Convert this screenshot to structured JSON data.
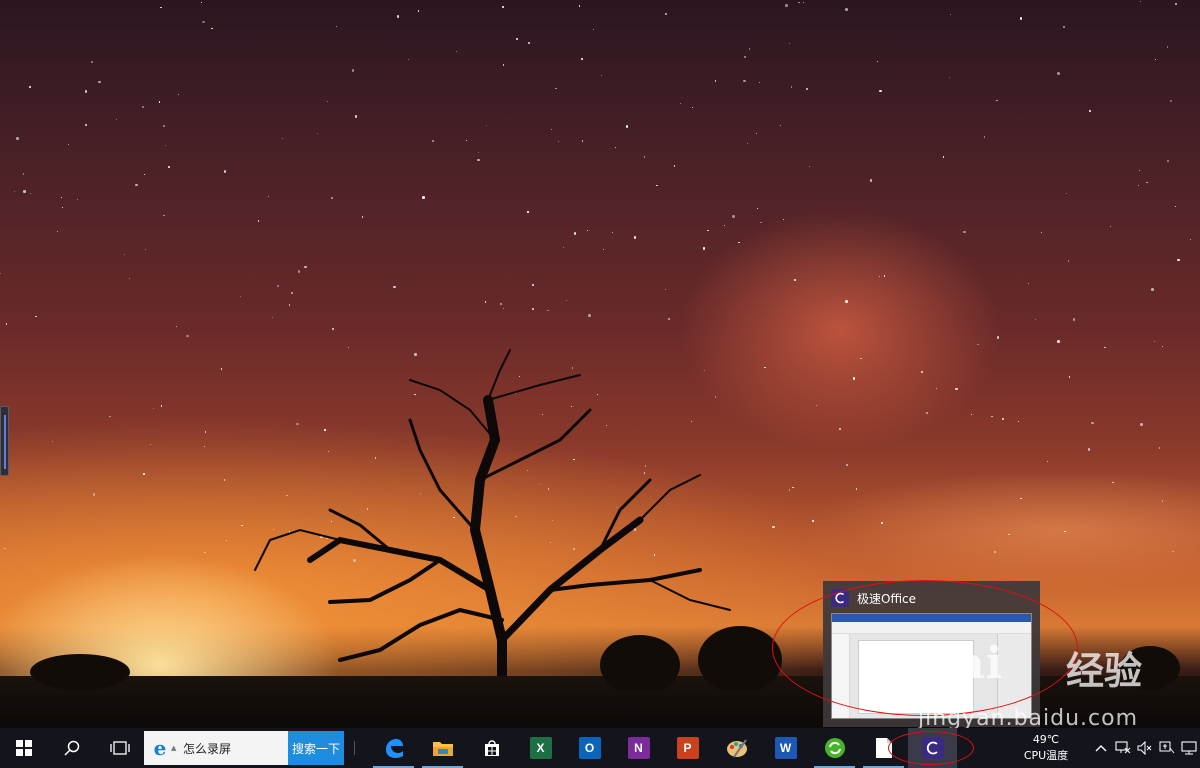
{
  "taskbar": {
    "search_text": "怎么录屏",
    "search_button_label": "搜索一下",
    "apps": [
      {
        "name": "edge",
        "icon": "edge-icon",
        "color": "#1e90ff",
        "letter": "e"
      },
      {
        "name": "file-explorer",
        "icon": "folder-icon",
        "color": "#f5c242",
        "letter": ""
      },
      {
        "name": "store",
        "icon": "store-icon",
        "color": "#ffffff",
        "letter": ""
      },
      {
        "name": "excel",
        "icon": "excel-icon",
        "color": "#1d7044",
        "letter": "X"
      },
      {
        "name": "outlook",
        "icon": "outlook-icon",
        "color": "#0a64b8",
        "letter": "O"
      },
      {
        "name": "onenote",
        "icon": "onenote-icon",
        "color": "#7b2c9a",
        "letter": "N"
      },
      {
        "name": "powerpoint",
        "icon": "powerpoint-icon",
        "color": "#c8421e",
        "letter": "P"
      },
      {
        "name": "paint",
        "icon": "paint-palette-icon",
        "color": "#e8c27a",
        "letter": ""
      },
      {
        "name": "word",
        "icon": "word-icon",
        "color": "#1d58b4",
        "letter": "W"
      },
      {
        "name": "refresh-app",
        "icon": "green-circle-icon",
        "color": "#48b42a",
        "letter": ""
      },
      {
        "name": "notepad",
        "icon": "document-icon",
        "color": "#ffffff",
        "letter": ""
      },
      {
        "name": "jisu-office",
        "icon": "jisu-office-icon",
        "color": "#3c2a82",
        "letter": "C"
      }
    ],
    "cpu_temp": "49℃",
    "cpu_label": "CPU温度"
  },
  "preview": {
    "title": "极速Office"
  },
  "watermark": {
    "logo": "Bai",
    "logo_right": "经验",
    "url": "jingyan.baidu.com"
  },
  "colors": {
    "taskbar_bg": "#14141c",
    "search_button_bg": "#1e8de0",
    "annotation_red": "#e01010"
  }
}
